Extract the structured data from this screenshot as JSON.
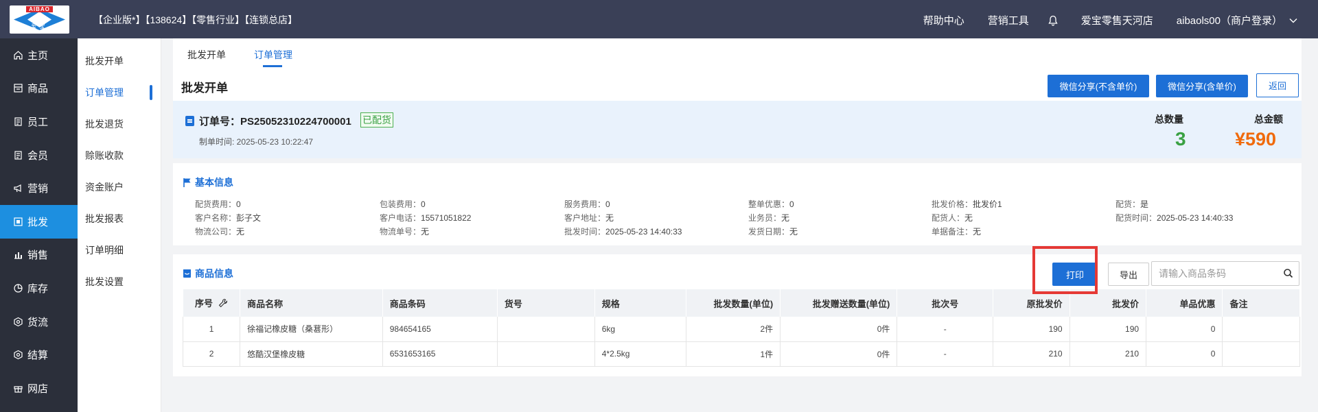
{
  "logo": {
    "brand": "AIBAO",
    "cn": "爱宝"
  },
  "header": {
    "title": "【企业版*】【138624】【零售行业】【连锁总店】",
    "help": "帮助中心",
    "marketing_tools": "营销工具",
    "store": "爱宝零售天河店",
    "user": "aibaols00（商户登录）"
  },
  "sidebar": {
    "items": [
      {
        "label": "主页",
        "icon": "home-icon"
      },
      {
        "label": "商品",
        "icon": "goods-icon"
      },
      {
        "label": "员工",
        "icon": "staff-icon"
      },
      {
        "label": "会员",
        "icon": "member-icon"
      },
      {
        "label": "营销",
        "icon": "megaphone-icon"
      },
      {
        "label": "批发",
        "icon": "wholesale-icon"
      },
      {
        "label": "销售",
        "icon": "bar-chart-icon"
      },
      {
        "label": "库存",
        "icon": "inventory-icon"
      },
      {
        "label": "货流",
        "icon": "logistics-icon"
      },
      {
        "label": "结算",
        "icon": "settlement-icon"
      },
      {
        "label": "网店",
        "icon": "gift-icon"
      }
    ],
    "active": "批发"
  },
  "subnav": {
    "items": [
      "批发开单",
      "订单管理",
      "批发退货",
      "赊账收款",
      "资金账户",
      "批发报表",
      "订单明细",
      "批发设置"
    ],
    "active": "订单管理"
  },
  "tabs": [
    "批发开单",
    "订单管理"
  ],
  "page": {
    "title": "批发开单",
    "share_without_price": "微信分享(不含单价)",
    "share_with_price": "微信分享(含单价)",
    "back": "返回"
  },
  "order": {
    "number_label": "订单号：PS25052310224700001",
    "status": "已配货",
    "created_time": "制单时间:   2025-05-23 10:22:47",
    "total_qty_label": "总数量",
    "total_qty": "3",
    "total_amount_label": "总金额",
    "total_amount": "¥590"
  },
  "basic_info": {
    "title": "基本信息",
    "fields": [
      {
        "label": "配货费用：",
        "value": "0"
      },
      {
        "label": "包装费用：",
        "value": "0"
      },
      {
        "label": "服务费用：",
        "value": "0"
      },
      {
        "label": "整单优惠：",
        "value": "0"
      },
      {
        "label": "批发价格：",
        "value": "批发价1"
      },
      {
        "label": "配货：",
        "value": "是"
      },
      {
        "label": "客户名称：",
        "value": "彭子文"
      },
      {
        "label": "客户电话：",
        "value": "15571051822"
      },
      {
        "label": "客户地址：",
        "value": "无"
      },
      {
        "label": "业务员：",
        "value": "无"
      },
      {
        "label": "配货人：",
        "value": "无"
      },
      {
        "label": "配货时间：",
        "value": "2025-05-23 14:40:33"
      },
      {
        "label": "物流公司：",
        "value": "无"
      },
      {
        "label": "物流单号：",
        "value": "无"
      },
      {
        "label": "批发时间：",
        "value": "2025-05-23 14:40:33"
      },
      {
        "label": "发货日期：",
        "value": "无"
      },
      {
        "label": "单据备注：",
        "value": "无"
      }
    ]
  },
  "products": {
    "title": "商品信息",
    "print": "打印",
    "export": "导出",
    "search_placeholder": "请输入商品条码",
    "columns": [
      "序号",
      "商品名称",
      "商品条码",
      "货号",
      "规格",
      "批发数量(单位)",
      "批发赠送数量(单位)",
      "批次号",
      "原批发价",
      "批发价",
      "单品优惠",
      "备注"
    ],
    "rows": [
      [
        "1",
        "徐福记橡皮糖（桑葚形）",
        "984654165",
        "",
        "6kg",
        "2件",
        "0件",
        "-",
        "190",
        "190",
        "0",
        ""
      ],
      [
        "2",
        "悠酷汉堡橡皮糖",
        "6531653165",
        "",
        "4*2.5kg",
        "1件",
        "0件",
        "-",
        "210",
        "210",
        "0",
        ""
      ]
    ]
  },
  "colors": {
    "accent": "#1d6fd6",
    "sidebar_active": "#1d8fe0",
    "header": "#3a4057",
    "green": "#3aa143",
    "orange": "#f06a0c",
    "highlight": "#e53935"
  }
}
